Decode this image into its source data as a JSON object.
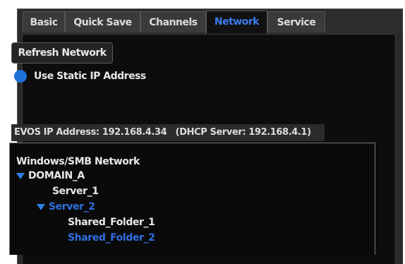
{
  "tabs": [
    {
      "label": "Basic",
      "active": false
    },
    {
      "label": "Quick Save",
      "active": false
    },
    {
      "label": "Channels",
      "active": false
    },
    {
      "label": "Network",
      "active": true
    },
    {
      "label": "Service",
      "active": false
    }
  ],
  "network": {
    "refresh_button": "Refresh Network",
    "static_ip_label": "Use Static IP Address",
    "ip_address_text": "EVOS IP Address: 192.168.4.34",
    "dhcp_server_text": "(DHCP Server: 192.168.4.1)"
  },
  "tree": {
    "root": "Windows/SMB Network",
    "domain": "DOMAIN_A",
    "server_1": "Server_1",
    "server_2": "Server_2",
    "folder_1": "Shared_Folder_1",
    "folder_2": "Shared_Folder_2"
  },
  "colors": {
    "accent": "#2f6fe0",
    "panel_bg": "#0d0d0d",
    "window_bg": "#2a2a2a"
  },
  "icons": {
    "radio": "radio-selected-icon",
    "expand": "triangle-down-icon"
  }
}
